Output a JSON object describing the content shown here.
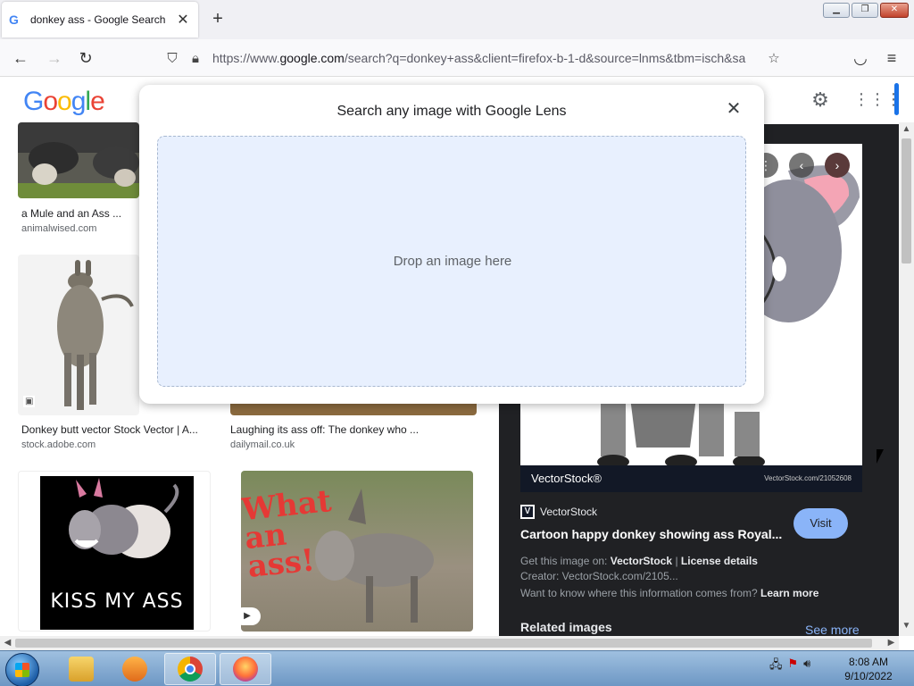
{
  "browser": {
    "tab_title": "donkey ass - Google Search",
    "tab_favicon": "G",
    "url_prefix": "https://www.",
    "url_domain": "google.com",
    "url_rest": "/search?q=donkey+ass&client=firefox-b-1-d&source=lnms&tbm=isch&sa"
  },
  "google": {
    "logo_letters": [
      "G",
      "o",
      "o",
      "g",
      "l",
      "e"
    ]
  },
  "results": [
    {
      "caption": "a Mule and an Ass ...",
      "source": "animalwised.com"
    },
    {
      "caption": "Donkey butt vector Stock Vector | A...",
      "source": "stock.adobe.com"
    },
    {
      "caption": "Laughing its ass off: The donkey who ...",
      "source": "dailymail.co.uk"
    },
    {
      "caption": "KISS MY ASS",
      "source": ""
    },
    {
      "caption": "What an ass!",
      "source": ""
    }
  ],
  "side_panel": {
    "watermark_logo": "VectorStock®",
    "watermark_url": "VectorStock.com/21052608",
    "source_name": "VectorStock",
    "title": "Cartoon happy donkey showing ass Royal...",
    "visit_label": "Visit",
    "get_image_prefix": "Get this image on:",
    "get_image_site": "VectorStock",
    "license": "License details",
    "creator": "Creator: VectorStock.com/2105...",
    "info_question": "Want to know where this information comes from?",
    "learn_more": "Learn more",
    "related": "Related images",
    "see_more": "See more"
  },
  "lens": {
    "title": "Search any image with Google Lens",
    "drop_text": "Drop an image here"
  },
  "taskbar": {
    "time": "8:08 AM",
    "date": "9/10/2022"
  },
  "colors": {
    "accent": "#1a73e8",
    "dropzone": "#e8f0fe",
    "panel_bg": "#202124",
    "visit_btn": "#8ab4f8"
  }
}
